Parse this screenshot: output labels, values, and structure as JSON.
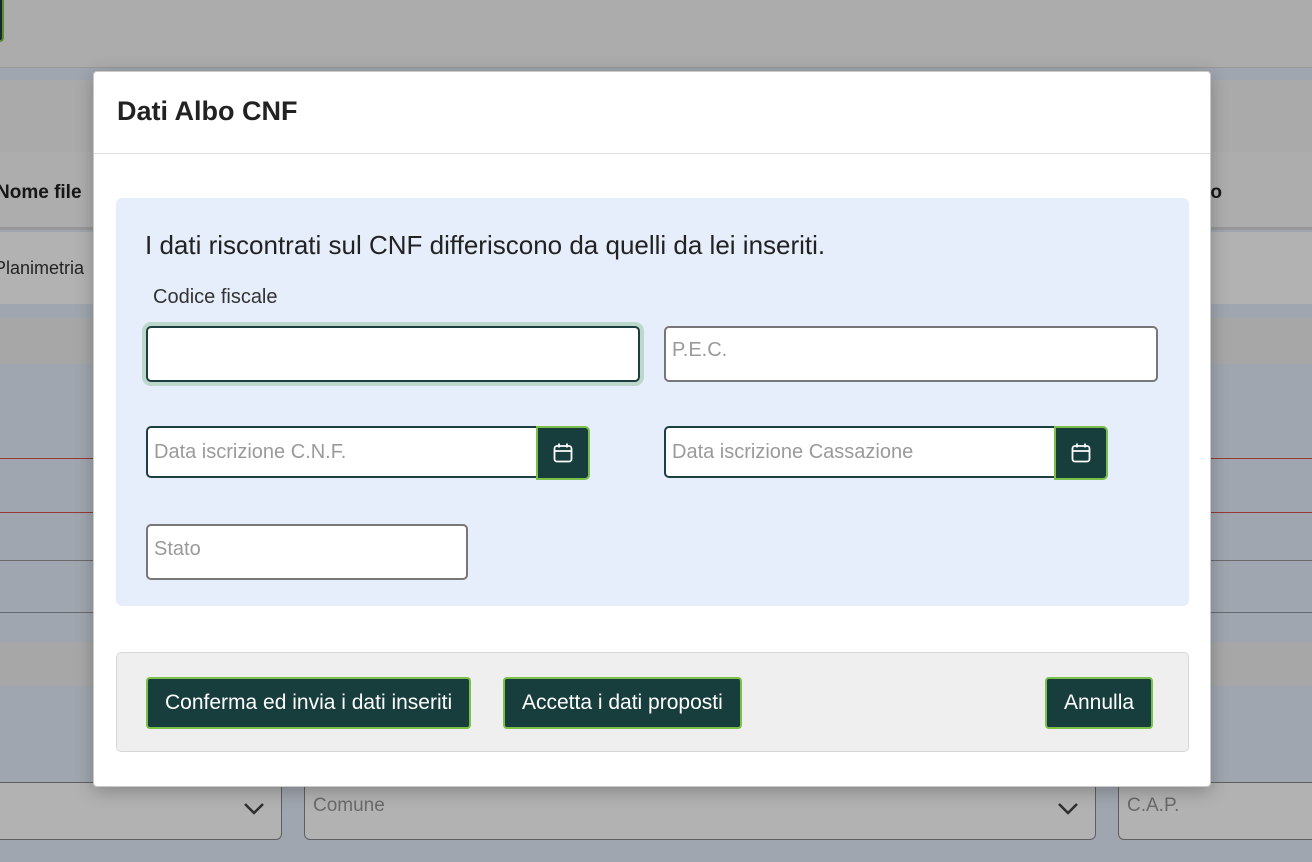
{
  "background": {
    "table_headers": [
      "Nome file",
      "to"
    ],
    "row_cell": "Planimetria",
    "comune_placeholder": "Comune",
    "cap_placeholder": "C.A.P."
  },
  "modal": {
    "title": "Dati Albo CNF",
    "message": "I dati riscontrati sul CNF differiscono da quelli da lei inseriti.",
    "codice_fiscale": {
      "label": "Codice fiscale",
      "value": ""
    },
    "pec": {
      "placeholder": "P.E.C.",
      "value": ""
    },
    "data_iscrizione_cnf": {
      "placeholder": "Data iscrizione C.N.F.",
      "value": ""
    },
    "data_iscrizione_cassazione": {
      "placeholder": "Data iscrizione Cassazione",
      "value": ""
    },
    "stato": {
      "placeholder": "Stato",
      "value": ""
    },
    "buttons": {
      "confirm": "Conferma ed invia i dati inseriti",
      "accept": "Accetta i dati proposti",
      "cancel": "Annulla"
    }
  },
  "colors": {
    "button_bg": "#173d3d",
    "button_border": "#7bc04a",
    "panel_bg": "#e6eefb"
  },
  "icons": [
    "calendar-icon",
    "chevron-down-icon"
  ]
}
